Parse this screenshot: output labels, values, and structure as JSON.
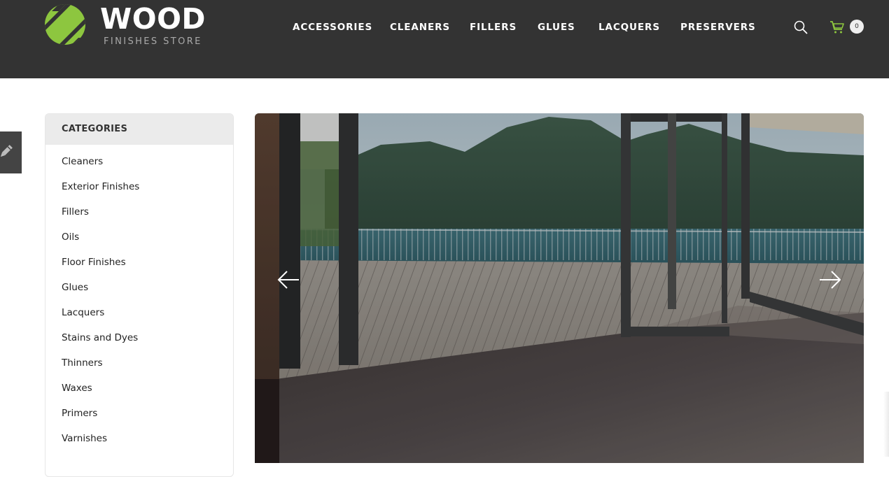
{
  "brand": {
    "name": "WOOD",
    "tagline": "FINISHES STORE",
    "accent_color": "#8dc63f",
    "header_color": "#333333"
  },
  "nav": {
    "items": [
      {
        "label": "ACCESSORIES"
      },
      {
        "label": "CLEANERS"
      },
      {
        "label": "FILLERS"
      },
      {
        "label": "GLUES"
      },
      {
        "label": "LACQUERS"
      },
      {
        "label": "PRESERVERS"
      }
    ]
  },
  "header_actions": {
    "search_icon": "search-icon",
    "cart_icon": "cart-icon",
    "cart_count": "0"
  },
  "side_tab": {
    "icon": "pencil-icon"
  },
  "categories": {
    "title": "CATEGORIES",
    "items": [
      {
        "label": "Cleaners"
      },
      {
        "label": "Exterior Finishes"
      },
      {
        "label": "Fillers"
      },
      {
        "label": "Oils"
      },
      {
        "label": "Floor Finishes"
      },
      {
        "label": "Glues"
      },
      {
        "label": "Lacquers"
      },
      {
        "label": "Stains and Dyes"
      },
      {
        "label": "Thinners"
      },
      {
        "label": "Waxes"
      },
      {
        "label": "Primers"
      },
      {
        "label": "Varnishes"
      }
    ]
  },
  "slider": {
    "image_alt": "Wooden floor opening onto a terrace with lake and mountain view",
    "prev_icon": "arrow-left-icon",
    "next_icon": "arrow-right-icon"
  }
}
